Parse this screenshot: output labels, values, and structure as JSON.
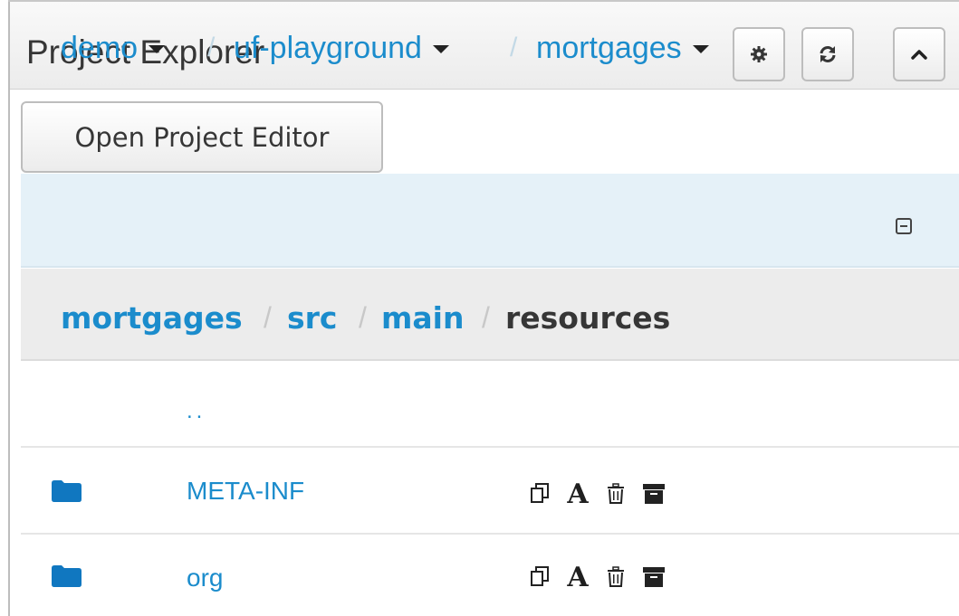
{
  "panel": {
    "title": "Project Explorer",
    "buttons": [
      {
        "name": "settings",
        "icon": "gear-icon"
      },
      {
        "name": "refresh",
        "icon": "refresh-icon"
      },
      {
        "name": "collapse-panel",
        "icon": "chevron-up-icon"
      }
    ]
  },
  "open_editor_label": "Open Project Editor",
  "context": {
    "organizational_unit": "demo",
    "repository": "uf-playground",
    "project": "mortgages",
    "separator": "/",
    "collapse_icon": "collapse-icon"
  },
  "path": {
    "separator": "/",
    "crumbs": [
      {
        "label": "mortgages",
        "link": true
      },
      {
        "label": "src",
        "link": true
      },
      {
        "label": "main",
        "link": true
      },
      {
        "label": "resources",
        "link": false
      }
    ]
  },
  "up_link": "..",
  "items": [
    {
      "name": "META-INF",
      "type": "folder",
      "actions": [
        "copy-icon",
        "rename-icon",
        "delete-icon",
        "archive-icon"
      ]
    },
    {
      "name": "org",
      "type": "folder",
      "actions": [
        "copy-icon",
        "rename-icon",
        "delete-icon",
        "archive-icon"
      ]
    }
  ],
  "rename_glyph": "A",
  "colors": {
    "link": "#1b8ccc",
    "context_bg": "#e5f1f8",
    "path_bg": "#ececec",
    "text": "#363636"
  }
}
